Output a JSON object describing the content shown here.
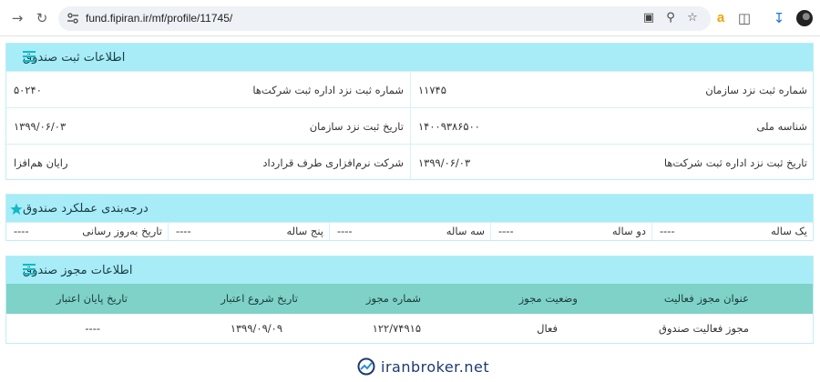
{
  "browser": {
    "url": "fund.fipiran.ir/mf/profile/11745/"
  },
  "registration": {
    "title": "اطلاعات ثبت صندوق",
    "rows": [
      {
        "right_label": "شماره ثبت نزد سازمان",
        "right_value": "۱۱۷۴۵",
        "left_label": "شماره ثبت نزد اداره ثبت شرکت‌ها",
        "left_value": "۵۰۲۴۰"
      },
      {
        "right_label": "شناسه ملی",
        "right_value": "۱۴۰۰۹۳۸۶۵۰۰",
        "left_label": "تاریخ ثبت نزد سازمان",
        "left_value": "۱۳۹۹/۰۶/۰۳"
      },
      {
        "right_label": "تاریخ ثبت نزد اداره ثبت شرکت‌ها",
        "right_value": "۱۳۹۹/۰۶/۰۳",
        "left_label": "شرکت نرم‌افزاری طرف قرارداد",
        "left_value": "رایان هم‌افزا"
      }
    ]
  },
  "ranking": {
    "title": "درجه‌بندی عملکرد صندوق",
    "cells": [
      {
        "label": "یک ساله",
        "value": "----"
      },
      {
        "label": "دو ساله",
        "value": "----"
      },
      {
        "label": "سه ساله",
        "value": "----"
      },
      {
        "label": "پنج ساله",
        "value": "----"
      },
      {
        "label": "تاریخ به‌روز رسانی",
        "value": "----"
      }
    ]
  },
  "license": {
    "title": "اطلاعات مجوز صندوق",
    "headers": [
      "عنوان مجوز فعالیت",
      "وضعیت مجوز",
      "شماره مجوز",
      "تاریخ شروع اعتبار",
      "تاریخ پایان اعتبار"
    ],
    "rows": [
      [
        "مجوز فعالیت صندوق",
        "فعال",
        "۱۲۲/۷۴۹۱۵",
        "۱۳۹۹/۰۹/۰۹",
        "----"
      ]
    ]
  },
  "footer": {
    "brand": "iranbroker.net"
  },
  "colors": {
    "panel_header": "#a7ecf7",
    "table_header": "#7ed2c8",
    "accent_icon": "#13b8c4"
  }
}
